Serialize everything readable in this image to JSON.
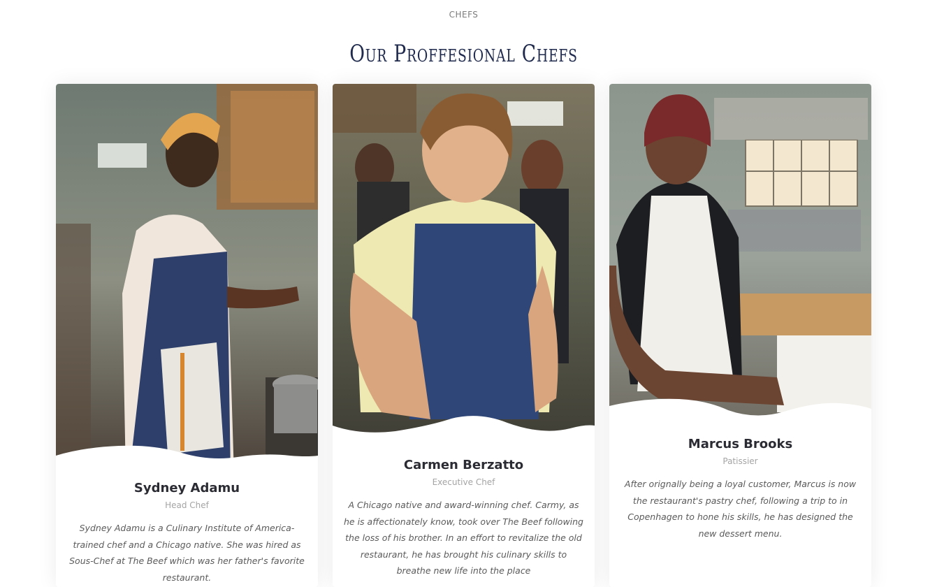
{
  "header": {
    "eyebrow": "CHEFS",
    "title": "Our Proffesional Chefs"
  },
  "chefs": [
    {
      "name": "Sydney Adamu",
      "role": "Head Chef",
      "bio": "Sydney Adamu is a Culinary Institute of America-trained chef and a Chicago native. She was hired as Sous-Chef at The Beef which was her father's favorite restaurant.",
      "photo": "chef-photo-sydney"
    },
    {
      "name": "Carmen Berzatto",
      "role": "Executive Chef",
      "bio": "A Chicago native and award-winning chef. Carmy, as he is affectionately know, took over The Beef following the loss of his brother. In an effort to revitalize the old restaurant, he has brought his culinary skills to breathe new life into the place",
      "photo": "chef-photo-carmen"
    },
    {
      "name": "Marcus Brooks",
      "role": "Patissier",
      "bio": "After orignally being a loyal customer, Marcus is now the restaurant's pastry chef, following a trip to in Copenhagen to hone his skills, he has designed the new dessert menu.",
      "photo": "chef-photo-marcus"
    }
  ],
  "colors": {
    "title": "#1f2a4d",
    "name": "#2b2b33",
    "role": "#a4a4a4",
    "bio": "#5a5a5a",
    "eyebrow": "#7c7c7c"
  }
}
